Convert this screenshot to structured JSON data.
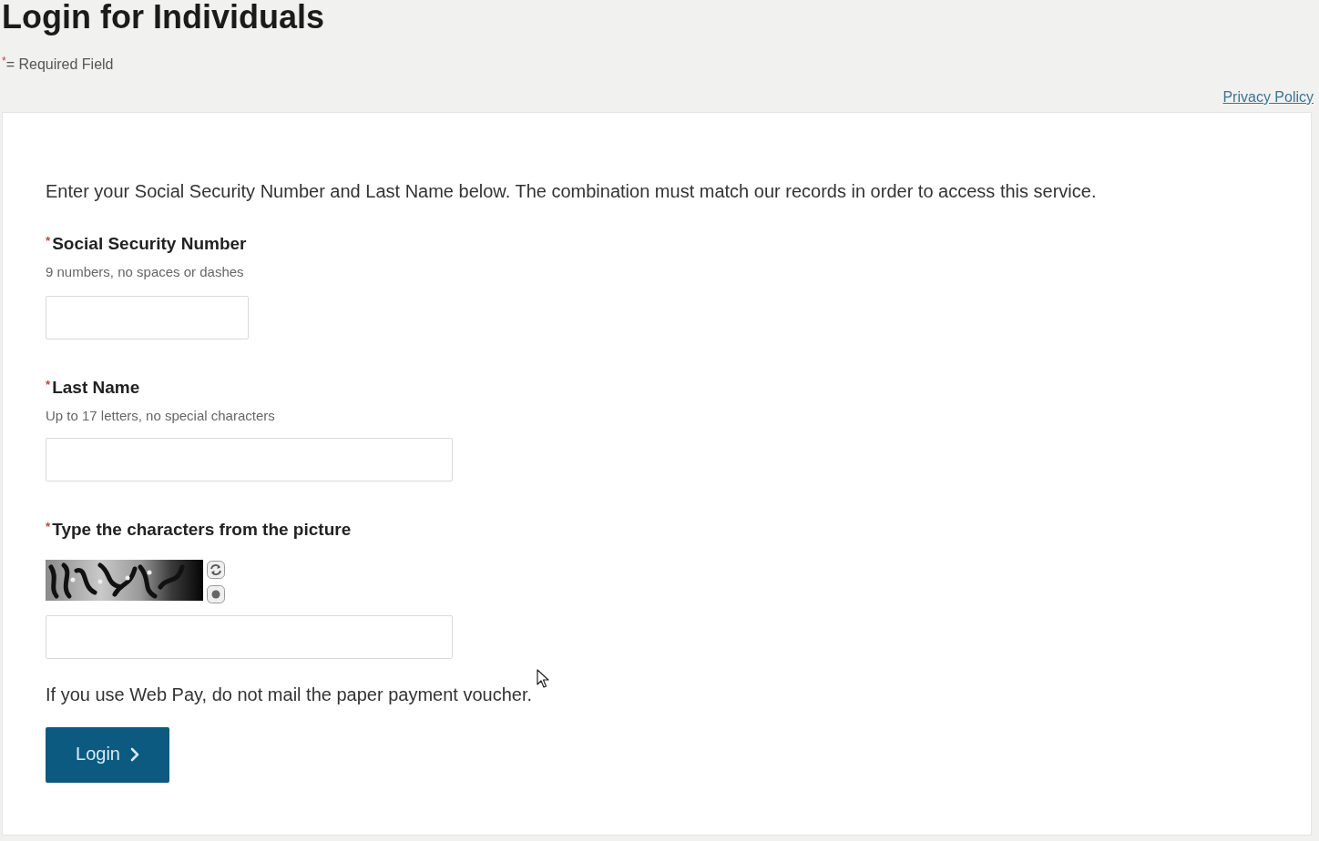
{
  "header": {
    "title": "Login for Individuals",
    "required_note": "$^{*}$= Required Field",
    "privacy_link": "Privacy Policy"
  },
  "form": {
    "intro": "Enter your Social Security Number and Last Name below. The combination must match our records in order to access this service.",
    "fields": [
      {
        "kind": "number",
        "label": "$^{*}$Social Security Number",
        "hint": "9 numbers, no spaces or dashes"
      },
      {
        "kind": "text",
        "label": "$^{*}$Last Name",
        "hint": "Up to 17 letters, no special characters"
      },
      {
        "kind": "captcha",
        "label": "$^{*}$Type the characters from the picture"
      }
    ],
    "notice": "If you use Web Pay, do not mail the paper payment voucher.",
    "submit": "Login"
  }
}
